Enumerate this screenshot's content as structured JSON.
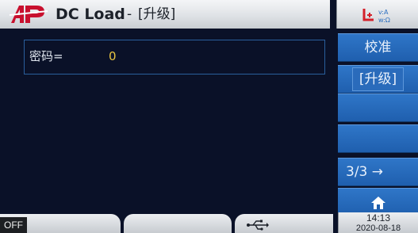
{
  "title": {
    "logo": "AP",
    "main": "DC Load",
    "separator": "-",
    "page": "[升级]"
  },
  "topright": {
    "remote_icon": "remote-sense-icon"
  },
  "form": {
    "password_label": "密码=",
    "password_value": "0"
  },
  "softkeys": {
    "calibrate": "校准",
    "upgrade": "[升级]",
    "key3": "",
    "key4": "",
    "page": "3/3 →",
    "home_icon": "home-icon"
  },
  "status": {
    "output_state": "OFF",
    "usb_icon": "usb-icon",
    "time": "14:13",
    "date": "2020-08-18"
  },
  "colors": {
    "background": "#0a1128",
    "softkey": "#1f5fae",
    "value_text": "#e8c542",
    "logo_red": "#c8102e"
  }
}
